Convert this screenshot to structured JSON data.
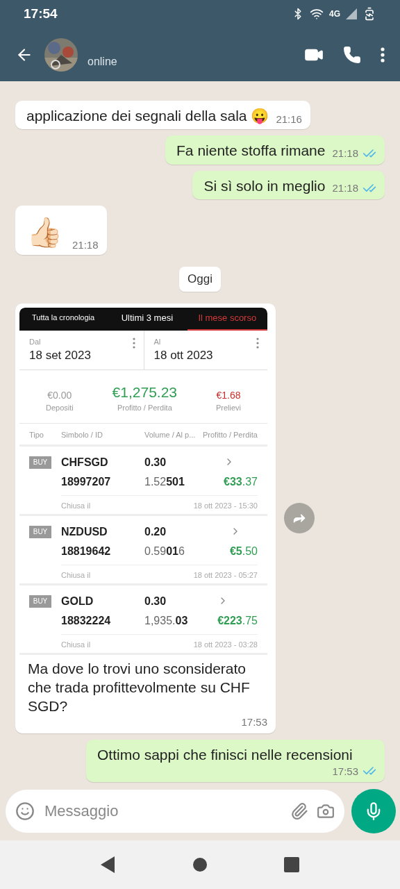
{
  "status_bar": {
    "time": "17:54",
    "network": "4G"
  },
  "header": {
    "status": "online"
  },
  "messages": [
    {
      "kind": "text",
      "outgoing": false,
      "text": "applicazione dei segnali della sala 😛",
      "time": "21:16"
    },
    {
      "kind": "text",
      "outgoing": true,
      "text": "Fa niente stoffa rimane",
      "time": "21:18",
      "read": true
    },
    {
      "kind": "text",
      "outgoing": true,
      "text": "Si sì solo in meglio",
      "time": "21:18",
      "read": true
    },
    {
      "kind": "emoji",
      "outgoing": false,
      "text": "👍🏻",
      "time": "21:18"
    },
    {
      "kind": "date",
      "text": "Oggi"
    },
    {
      "outgoing": false,
      "text": "Ma dove lo trovi uno sconsiderato che trada profittevolmente su CHF SGD?",
      "time": "17:53",
      "screenshot": {
        "tabs": [
          {
            "label": "Tutta la cronologia",
            "selected": false
          },
          {
            "label": "Ultimi 3 mesi",
            "selected": false
          },
          {
            "label": "Il mese scorso",
            "selected": true
          }
        ],
        "range": [
          {
            "label": "Dal",
            "value": "18 set 2023"
          },
          {
            "label": "Al",
            "value": "18 ott 2023"
          }
        ],
        "summary": [
          {
            "value": "€0.00",
            "label": "Depositi",
            "color": "#999999"
          },
          {
            "value": "€1,275.23",
            "label": "Profitto / Perdita",
            "color": "#2f9e52"
          },
          {
            "value": "€1.68",
            "label": "Prelievi",
            "color": "#c62c2c"
          }
        ],
        "columns": [
          "Tipo",
          "Simbolo / ID",
          "Volume / Al p...",
          "Profitto / Perdita"
        ],
        "trades": [
          {
            "type": "BUY",
            "symbol": "CHFSGD",
            "volume": "0.30",
            "id": "18997207",
            "price": "1.52**501**",
            "profit": "**€33**.37",
            "closed_label": "Chiusa il",
            "closed_at": "18 ott 2023 - 15:30"
          },
          {
            "type": "BUY",
            "symbol": "NZDUSD",
            "volume": "0.20",
            "id": "18819642",
            "price": "0.59**01**6",
            "profit": "**€5**.50",
            "closed_label": "Chiusa il",
            "closed_at": "18 ott 2023 - 05:27"
          },
          {
            "type": "BUY",
            "symbol": "GOLD",
            "volume": "0.30",
            "id": "18832224",
            "price": "1,935.**03**",
            "profit": "**€223**.75",
            "closed_label": "Chiusa il",
            "closed_at": "18 ott 2023 - 03:28"
          }
        ]
      }
    },
    {
      "kind": "text",
      "outgoing": true,
      "text": "Ottimo sappi che finisci nelle recensioni",
      "time": "17:53",
      "read": true
    }
  ],
  "composer": {
    "placeholder": "Messaggio"
  }
}
